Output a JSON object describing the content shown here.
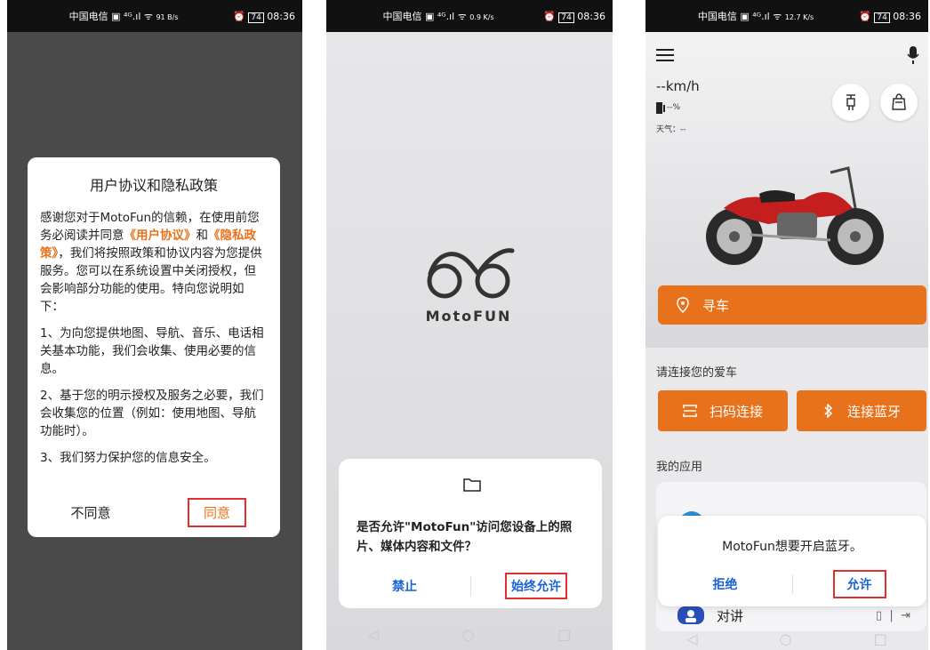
{
  "status": {
    "carrier": "中国电信",
    "phone1_speed": "91 B/s",
    "phone2_speed": "0.9 K/s",
    "phone3_speed": "12.7 K/s",
    "battery": "74",
    "time": "08:36"
  },
  "phone1": {
    "title": "用户协议和隐私政策",
    "para1_a": "感谢您对于MotoFun的信赖，在使用前您务必阅读并同意",
    "link_user": "《用户协议》",
    "para1_and": "和",
    "link_privacy": "《隐私政策》",
    "para1_b": "，我们将按照政策和协议内容为您提供服务。您可以在系统设置中关闭授权，但会影响部分功能的使用。特向您说明如下：",
    "para2": "1、为向您提供地图、导航、音乐、电话相关基本功能，我们会收集、使用必要的信息。",
    "para3": "2、基于您的明示授权及服务之必要，我们会收集您的位置（例如：使用地图、导航功能时）。",
    "para4": "3、我们努力保护您的信息安全。",
    "disagree": "不同意",
    "agree": "同意"
  },
  "phone2": {
    "logo_text": "MotoFUN",
    "permission_text": "是否允许\"MotoFun\"访问您设备上的照片、媒体内容和文件？",
    "deny": "禁止",
    "allow_always": "始终允许"
  },
  "phone3": {
    "speed": "--km/h",
    "fuel": "--%",
    "weather": "天气：--",
    "find_car": "寻车",
    "connect_label": "请连接您的爱车",
    "scan_connect": "扫码连接",
    "bt_connect": "连接蓝牙",
    "my_apps": "我的应用",
    "intercom": "对讲",
    "bt_message": "MotoFun想要开启蓝牙。",
    "reject": "拒绝",
    "allow": "允许"
  },
  "colors": {
    "accent": "#e8711c",
    "link_blue": "#1a63d6",
    "highlight_box": "#e02f2f"
  }
}
